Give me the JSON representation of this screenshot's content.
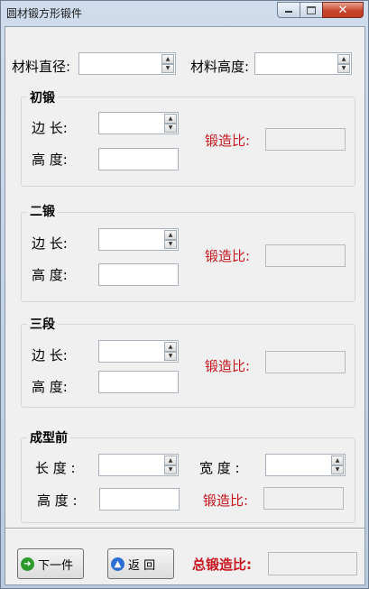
{
  "window": {
    "title": "圆材锻方形锻件",
    "min_icon": "minimize-icon",
    "max_icon": "maximize-icon",
    "close_icon": "close-icon"
  },
  "top": {
    "diameter_label": "材料直径:",
    "height_label": "材料高度:",
    "diameter_value": "",
    "height_value": ""
  },
  "groups": [
    {
      "title": "初锻",
      "side_label": "边    长:",
      "height_label": "高    度:",
      "ratio_label": "锻造比:",
      "side_value": "",
      "height_value": "",
      "ratio_value": ""
    },
    {
      "title": "二锻",
      "side_label": "边    长:",
      "height_label": "高    度:",
      "ratio_label": "锻造比:",
      "side_value": "",
      "height_value": "",
      "ratio_value": ""
    },
    {
      "title": "三段",
      "side_label": "边    长:",
      "height_label": "高    度:",
      "ratio_label": "锻造比:",
      "side_value": "",
      "height_value": "",
      "ratio_value": ""
    }
  ],
  "final": {
    "title": "成型前",
    "length_label": "长  度 :",
    "width_label": "宽  度 :",
    "height_label": "高  度 :",
    "ratio_label": "锻造比:"
  },
  "buttons": {
    "next_label": "下一件",
    "back_label": "返  回",
    "next_icon": "arrow-right-icon",
    "back_icon": "arrow-up-icon"
  },
  "total": {
    "label": "总锻造比:",
    "value": ""
  },
  "colors": {
    "accent_red": "#c8161e",
    "window_bg": "#f0f0f0",
    "icon_green": "#2e9a2e",
    "icon_blue": "#2a6fd1"
  }
}
